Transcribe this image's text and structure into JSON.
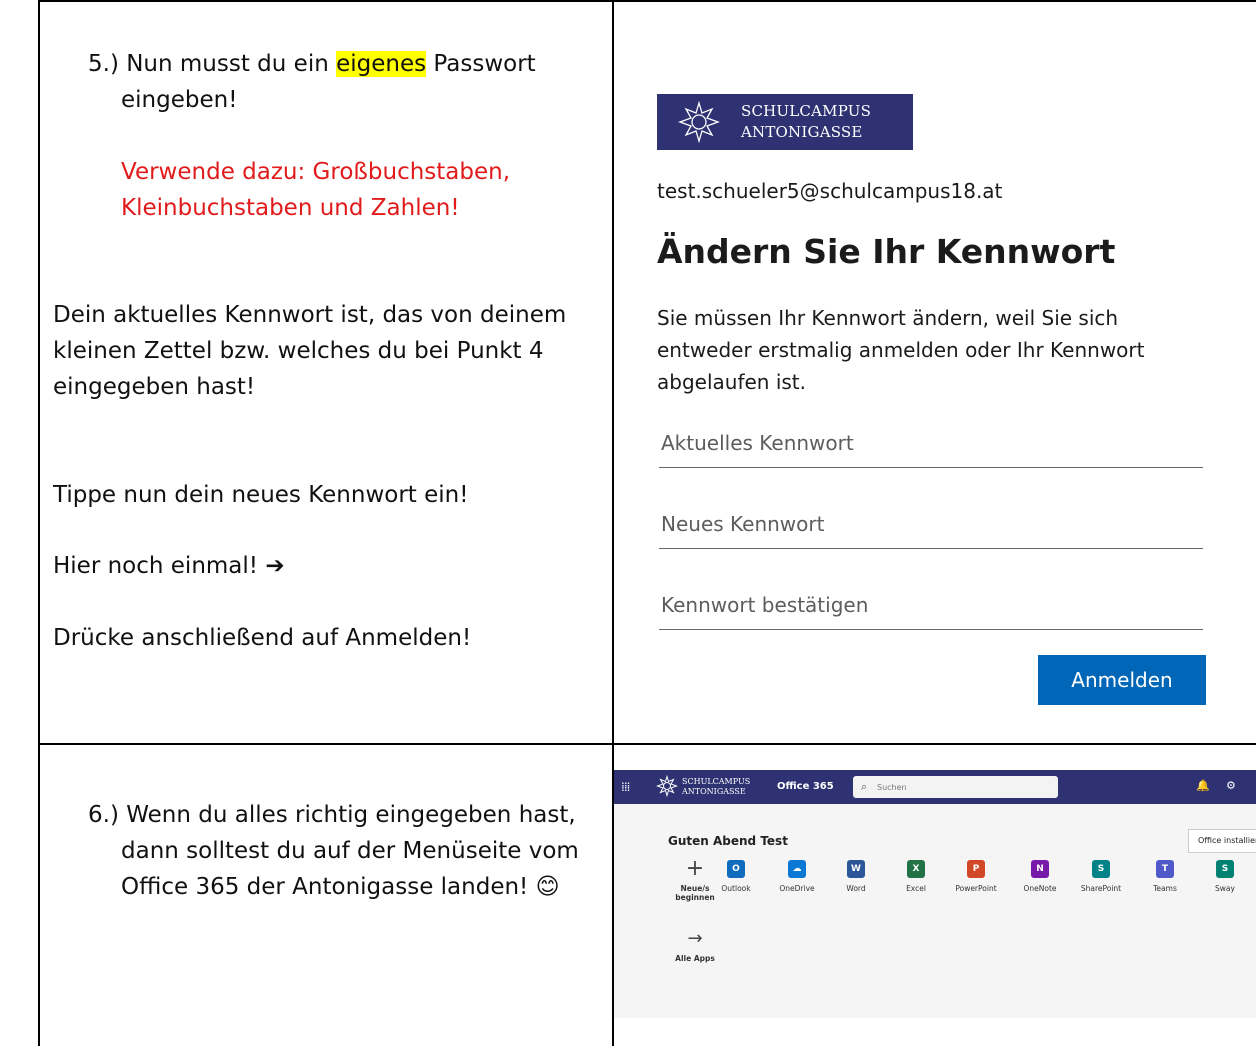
{
  "step5": {
    "line1_pre": "5.)  Nun musst du ein ",
    "line1_highlight": "eigenes",
    "line1_post": " Passwort",
    "line2": "eingeben!",
    "red1": "Verwende dazu: Großbuchstaben,",
    "red2": "Kleinbuchstaben und Zahlen!",
    "para1": [
      "Dein aktuelles Kennwort ist, das von deinem",
      "kleinen Zettel bzw. welches du bei Punkt 4",
      "eingegeben hast!"
    ],
    "para2": "Tippe nun dein neues Kennwort ein!",
    "para3": "Hier noch einmal! ➔",
    "para4": "Drücke anschließend auf Anmelden!"
  },
  "login": {
    "logo_line1": "SCHULCAMPUS",
    "logo_line2": "ANTONIGASSE",
    "email": "test.schueler5@schulcampus18.at",
    "heading": "Ändern Sie Ihr Kennwort",
    "description": [
      "Sie müssen Ihr Kennwort ändern, weil Sie sich",
      "entweder erstmalig anmelden oder Ihr Kennwort",
      "abgelaufen ist."
    ],
    "current_password_placeholder": "Aktuelles Kennwort",
    "new_password_placeholder": "Neues Kennwort",
    "confirm_password_placeholder": "Kennwort bestätigen",
    "signin_label": "Anmelden",
    "signin_color": "#0067b8",
    "brand_color": "#2e3272"
  },
  "step6": {
    "lines": [
      "6.)  Wenn du alles richtig eingegeben hast,",
      "dann solltest du auf der Menüseite vom",
      "Office 365 der Antonigasse landen! 😊"
    ]
  },
  "office": {
    "logo_line1": "SCHULCAMPUS",
    "logo_line2": "ANTONIGASSE",
    "title": "Office 365",
    "search_placeholder": "Suchen",
    "greeting": "Guten Abend Test",
    "install_label": "Office installier",
    "new_label_1": "Neue/s",
    "new_label_2": "beginnen",
    "all_apps_label": "Alle Apps",
    "apps": [
      {
        "name": "Outlook",
        "letter": "O",
        "color": "#0f6cbd"
      },
      {
        "name": "OneDrive",
        "letter": "☁",
        "color": "#0a78d4"
      },
      {
        "name": "Word",
        "letter": "W",
        "color": "#2b579a"
      },
      {
        "name": "Excel",
        "letter": "X",
        "color": "#217346"
      },
      {
        "name": "PowerPoint",
        "letter": "P",
        "color": "#d24726"
      },
      {
        "name": "OneNote",
        "letter": "N",
        "color": "#7719aa"
      },
      {
        "name": "SharePoint",
        "letter": "S",
        "color": "#038387"
      },
      {
        "name": "Teams",
        "letter": "T",
        "color": "#5059c9"
      },
      {
        "name": "Sway",
        "letter": "S",
        "color": "#008272"
      }
    ]
  }
}
